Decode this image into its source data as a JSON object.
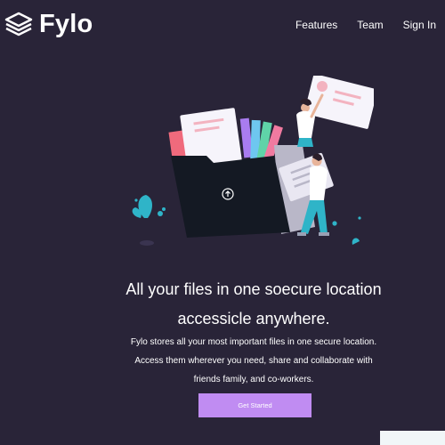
{
  "header": {
    "logo_text": "Fylo",
    "logo_icon": "stacked-layers-icon",
    "nav": [
      {
        "label": "Features"
      },
      {
        "label": "Team"
      },
      {
        "label": "Sign In"
      }
    ]
  },
  "hero": {
    "illustration_icon": "folder-upload-illustration",
    "headline_line1": "All your files in one soecure location",
    "headline_line2": "accessicle anywhere.",
    "subtext_line1": "Fylo stores all your most important files in one secure location.",
    "subtext_line2": "Access them wherever you need, share and collaborate with",
    "subtext_line3": "friends family, and co-workers.",
    "cta_label": "Get Started"
  },
  "colors": {
    "background": "#292438",
    "cta": "#c08cf2",
    "text": "#ffffff",
    "folder": "#141923",
    "accent_teal": "#2fb4c8"
  }
}
